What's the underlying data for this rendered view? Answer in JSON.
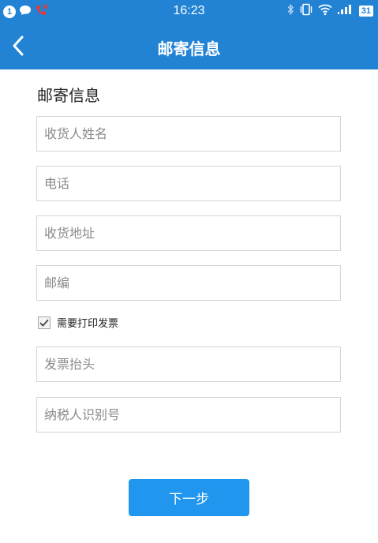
{
  "status_bar": {
    "notification_count": "1",
    "time": "16:23",
    "battery": "31",
    "icons": [
      "message-icon",
      "missed-call-icon",
      "bluetooth-icon",
      "vibrate-icon",
      "wifi-icon",
      "signal-icon",
      "battery-icon"
    ]
  },
  "header": {
    "title": "邮寄信息",
    "back_icon": "back-arrow-icon"
  },
  "form": {
    "section_title": "邮寄信息",
    "fields": {
      "recipient_name": {
        "placeholder": "收货人姓名",
        "value": ""
      },
      "phone": {
        "placeholder": "电话",
        "value": ""
      },
      "address": {
        "placeholder": "收货地址",
        "value": ""
      },
      "postcode": {
        "placeholder": "邮编",
        "value": ""
      },
      "invoice_title": {
        "placeholder": "发票抬头",
        "value": ""
      },
      "taxpayer_id": {
        "placeholder": "纳税人识别号",
        "value": ""
      }
    },
    "need_invoice": {
      "label": "需要打印发票",
      "checked": true
    },
    "next_button": "下一步"
  },
  "colors": {
    "primary": "#2283d4",
    "button": "#2196ee",
    "missed_call": "#e53935"
  }
}
